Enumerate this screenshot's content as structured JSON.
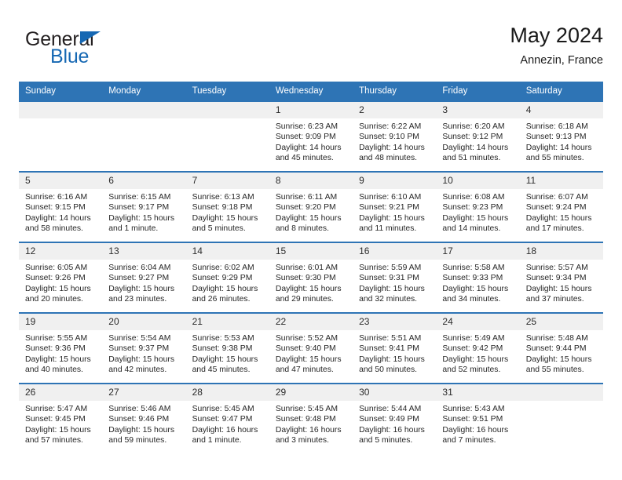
{
  "brand": {
    "name_top": "General",
    "name_bottom": "Blue",
    "triangle_color": "#1668b3"
  },
  "header": {
    "title": "May 2024",
    "subtitle": "Annezin, France"
  },
  "theme": {
    "header_blue": "#2e74b5",
    "daynum_gray": "#f0f0f0",
    "text": "#262626"
  },
  "weekdays": [
    "Sunday",
    "Monday",
    "Tuesday",
    "Wednesday",
    "Thursday",
    "Friday",
    "Saturday"
  ],
  "labels": {
    "sunrise": "Sunrise:",
    "sunset": "Sunset:",
    "daylight": "Daylight:"
  },
  "weeks": [
    [
      {
        "day": "",
        "empty": true
      },
      {
        "day": "",
        "empty": true
      },
      {
        "day": "",
        "empty": true
      },
      {
        "day": "1",
        "sunrise": "Sunrise: 6:23 AM",
        "sunset": "Sunset: 9:09 PM",
        "daylight1": "Daylight: 14 hours",
        "daylight2": "and 45 minutes."
      },
      {
        "day": "2",
        "sunrise": "Sunrise: 6:22 AM",
        "sunset": "Sunset: 9:10 PM",
        "daylight1": "Daylight: 14 hours",
        "daylight2": "and 48 minutes."
      },
      {
        "day": "3",
        "sunrise": "Sunrise: 6:20 AM",
        "sunset": "Sunset: 9:12 PM",
        "daylight1": "Daylight: 14 hours",
        "daylight2": "and 51 minutes."
      },
      {
        "day": "4",
        "sunrise": "Sunrise: 6:18 AM",
        "sunset": "Sunset: 9:13 PM",
        "daylight1": "Daylight: 14 hours",
        "daylight2": "and 55 minutes."
      }
    ],
    [
      {
        "day": "5",
        "sunrise": "Sunrise: 6:16 AM",
        "sunset": "Sunset: 9:15 PM",
        "daylight1": "Daylight: 14 hours",
        "daylight2": "and 58 minutes."
      },
      {
        "day": "6",
        "sunrise": "Sunrise: 6:15 AM",
        "sunset": "Sunset: 9:17 PM",
        "daylight1": "Daylight: 15 hours",
        "daylight2": "and 1 minute."
      },
      {
        "day": "7",
        "sunrise": "Sunrise: 6:13 AM",
        "sunset": "Sunset: 9:18 PM",
        "daylight1": "Daylight: 15 hours",
        "daylight2": "and 5 minutes."
      },
      {
        "day": "8",
        "sunrise": "Sunrise: 6:11 AM",
        "sunset": "Sunset: 9:20 PM",
        "daylight1": "Daylight: 15 hours",
        "daylight2": "and 8 minutes."
      },
      {
        "day": "9",
        "sunrise": "Sunrise: 6:10 AM",
        "sunset": "Sunset: 9:21 PM",
        "daylight1": "Daylight: 15 hours",
        "daylight2": "and 11 minutes."
      },
      {
        "day": "10",
        "sunrise": "Sunrise: 6:08 AM",
        "sunset": "Sunset: 9:23 PM",
        "daylight1": "Daylight: 15 hours",
        "daylight2": "and 14 minutes."
      },
      {
        "day": "11",
        "sunrise": "Sunrise: 6:07 AM",
        "sunset": "Sunset: 9:24 PM",
        "daylight1": "Daylight: 15 hours",
        "daylight2": "and 17 minutes."
      }
    ],
    [
      {
        "day": "12",
        "sunrise": "Sunrise: 6:05 AM",
        "sunset": "Sunset: 9:26 PM",
        "daylight1": "Daylight: 15 hours",
        "daylight2": "and 20 minutes."
      },
      {
        "day": "13",
        "sunrise": "Sunrise: 6:04 AM",
        "sunset": "Sunset: 9:27 PM",
        "daylight1": "Daylight: 15 hours",
        "daylight2": "and 23 minutes."
      },
      {
        "day": "14",
        "sunrise": "Sunrise: 6:02 AM",
        "sunset": "Sunset: 9:29 PM",
        "daylight1": "Daylight: 15 hours",
        "daylight2": "and 26 minutes."
      },
      {
        "day": "15",
        "sunrise": "Sunrise: 6:01 AM",
        "sunset": "Sunset: 9:30 PM",
        "daylight1": "Daylight: 15 hours",
        "daylight2": "and 29 minutes."
      },
      {
        "day": "16",
        "sunrise": "Sunrise: 5:59 AM",
        "sunset": "Sunset: 9:31 PM",
        "daylight1": "Daylight: 15 hours",
        "daylight2": "and 32 minutes."
      },
      {
        "day": "17",
        "sunrise": "Sunrise: 5:58 AM",
        "sunset": "Sunset: 9:33 PM",
        "daylight1": "Daylight: 15 hours",
        "daylight2": "and 34 minutes."
      },
      {
        "day": "18",
        "sunrise": "Sunrise: 5:57 AM",
        "sunset": "Sunset: 9:34 PM",
        "daylight1": "Daylight: 15 hours",
        "daylight2": "and 37 minutes."
      }
    ],
    [
      {
        "day": "19",
        "sunrise": "Sunrise: 5:55 AM",
        "sunset": "Sunset: 9:36 PM",
        "daylight1": "Daylight: 15 hours",
        "daylight2": "and 40 minutes."
      },
      {
        "day": "20",
        "sunrise": "Sunrise: 5:54 AM",
        "sunset": "Sunset: 9:37 PM",
        "daylight1": "Daylight: 15 hours",
        "daylight2": "and 42 minutes."
      },
      {
        "day": "21",
        "sunrise": "Sunrise: 5:53 AM",
        "sunset": "Sunset: 9:38 PM",
        "daylight1": "Daylight: 15 hours",
        "daylight2": "and 45 minutes."
      },
      {
        "day": "22",
        "sunrise": "Sunrise: 5:52 AM",
        "sunset": "Sunset: 9:40 PM",
        "daylight1": "Daylight: 15 hours",
        "daylight2": "and 47 minutes."
      },
      {
        "day": "23",
        "sunrise": "Sunrise: 5:51 AM",
        "sunset": "Sunset: 9:41 PM",
        "daylight1": "Daylight: 15 hours",
        "daylight2": "and 50 minutes."
      },
      {
        "day": "24",
        "sunrise": "Sunrise: 5:49 AM",
        "sunset": "Sunset: 9:42 PM",
        "daylight1": "Daylight: 15 hours",
        "daylight2": "and 52 minutes."
      },
      {
        "day": "25",
        "sunrise": "Sunrise: 5:48 AM",
        "sunset": "Sunset: 9:44 PM",
        "daylight1": "Daylight: 15 hours",
        "daylight2": "and 55 minutes."
      }
    ],
    [
      {
        "day": "26",
        "sunrise": "Sunrise: 5:47 AM",
        "sunset": "Sunset: 9:45 PM",
        "daylight1": "Daylight: 15 hours",
        "daylight2": "and 57 minutes."
      },
      {
        "day": "27",
        "sunrise": "Sunrise: 5:46 AM",
        "sunset": "Sunset: 9:46 PM",
        "daylight1": "Daylight: 15 hours",
        "daylight2": "and 59 minutes."
      },
      {
        "day": "28",
        "sunrise": "Sunrise: 5:45 AM",
        "sunset": "Sunset: 9:47 PM",
        "daylight1": "Daylight: 16 hours",
        "daylight2": "and 1 minute."
      },
      {
        "day": "29",
        "sunrise": "Sunrise: 5:45 AM",
        "sunset": "Sunset: 9:48 PM",
        "daylight1": "Daylight: 16 hours",
        "daylight2": "and 3 minutes."
      },
      {
        "day": "30",
        "sunrise": "Sunrise: 5:44 AM",
        "sunset": "Sunset: 9:49 PM",
        "daylight1": "Daylight: 16 hours",
        "daylight2": "and 5 minutes."
      },
      {
        "day": "31",
        "sunrise": "Sunrise: 5:43 AM",
        "sunset": "Sunset: 9:51 PM",
        "daylight1": "Daylight: 16 hours",
        "daylight2": "and 7 minutes."
      },
      {
        "day": "",
        "empty": true
      }
    ]
  ]
}
